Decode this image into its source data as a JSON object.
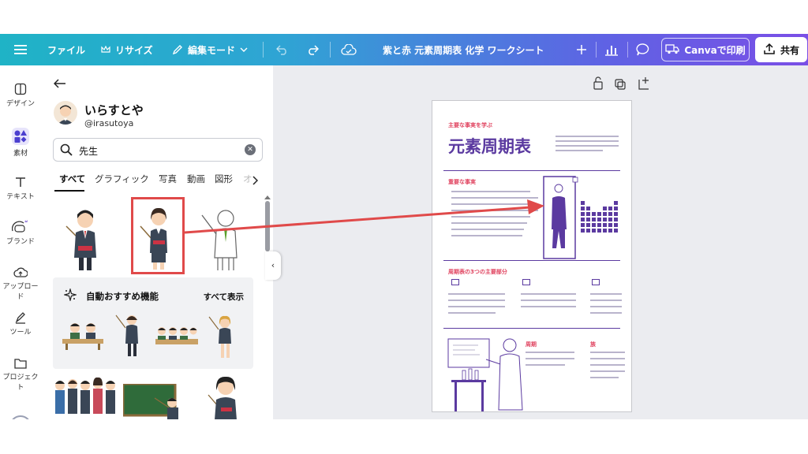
{
  "topbar": {
    "file": "ファイル",
    "resize": "リサイズ",
    "edit_mode": "編集モード",
    "title": "紫と赤 元素周期表 化学 ワークシート",
    "print": "Canvaで印刷",
    "share": "共有"
  },
  "rail": {
    "items": [
      "デザイン",
      "素材",
      "テキスト",
      "ブランド",
      "アップロード",
      "ツール",
      "プロジェクト"
    ]
  },
  "panel": {
    "creator_name": "いらすとや",
    "creator_handle": "@irasutoya",
    "search_value": "先生",
    "tabs": [
      "すべて",
      "グラフィック",
      "写真",
      "動画",
      "図形",
      "オ"
    ],
    "reco_title": "自動おすすめ機能",
    "reco_all": "すべて表示"
  },
  "doc": {
    "kicker": "主要な事実を学ぶ",
    "title": "元素周期表",
    "section1": "重要な事実",
    "section2": "周期表の3つの主要部分",
    "col_period": "周期",
    "col_group": "族"
  },
  "colors": {
    "accent_red": "#e04a4a",
    "doc_purple": "#5b3aa0",
    "doc_pink": "#e0435f"
  }
}
